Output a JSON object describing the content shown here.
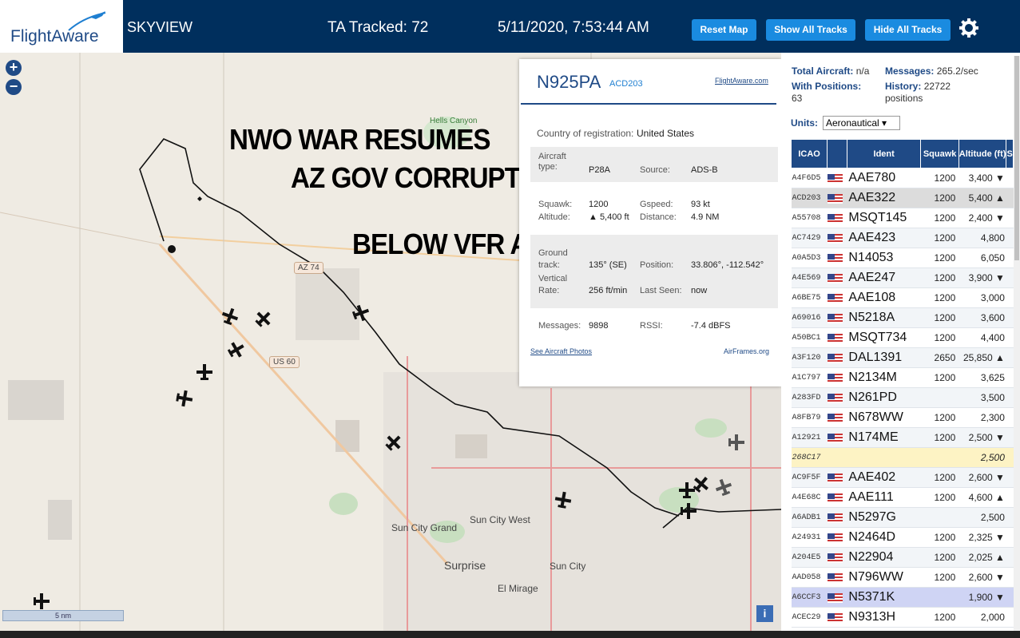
{
  "header": {
    "logo_text": "FlightAware",
    "app_name": "SKYVIEW",
    "ta_tracked": "TA Tracked: 72",
    "datetime": "5/11/2020, 7:53:44 AM",
    "reset_map": "Reset Map",
    "show_all": "Show All Tracks",
    "hide_all": "Hide All Tracks"
  },
  "map": {
    "zoom_in": "+",
    "zoom_out": "−",
    "overlay1": "NWO WAR RESUMES",
    "overlay2": "AZ GOV CORRUPTION",
    "overlay3": "BELOW VFR ASSHOLES",
    "places": [
      "Hells Canyon",
      "Sun City Grand",
      "Sun City West",
      "Surprise",
      "Sun City",
      "El Mirage"
    ],
    "shields": [
      "AZ 74",
      "US 60"
    ],
    "scale": "5 nm",
    "info": "i"
  },
  "popup": {
    "registration": "N925PA",
    "icao": "ACD203",
    "fa_link": "FlightAware.com",
    "country_label": "Country of registration:",
    "country": "United States",
    "aircraft_label": "Aircraft type:",
    "aircraft": "P28A",
    "source_label": "Source:",
    "source": "ADS-B",
    "squawk_label": "Squawk:",
    "squawk": "1200",
    "gspeed_label": "Gspeed:",
    "gspeed": "93 kt",
    "altitude_label": "Altitude:",
    "altitude": "▲ 5,400 ft",
    "distance_label": "Distance:",
    "distance": "4.9 NM",
    "track_label": "Ground track:",
    "track": "135° (SE)",
    "position_label": "Position:",
    "position": "33.806°, -112.542°",
    "vrate_label": "Vertical Rate:",
    "vrate": "256 ft/min",
    "lastseen_label": "Last Seen:",
    "lastseen": "now",
    "messages_label": "Messages:",
    "messages": "9898",
    "rssi_label": "RSSI:",
    "rssi": "-7.4 dBFS",
    "photos_link": "See Aircraft Photos",
    "airframes_link": "AirFrames.org"
  },
  "panel": {
    "total_label": "Total Aircraft:",
    "total": "n/a",
    "msgs_label": "Messages:",
    "msgs": "265.2/sec",
    "withpos_label": "With Positions:",
    "withpos": "63",
    "history_label": "History:",
    "history": "22722 positions",
    "units_label": "Units:",
    "units": "Aeronautical ▾",
    "columns": [
      "ICAO",
      "",
      "Ident",
      "Squawk",
      "Altitude (ft)",
      "S"
    ],
    "rows": [
      [
        "A4F6D5",
        "AAE780",
        "1200",
        "3,400 ▼"
      ],
      [
        "ACD203",
        "AAE322",
        "1200",
        "5,400 ▲"
      ],
      [
        "A55708",
        "MSQT145",
        "1200",
        "2,400 ▼"
      ],
      [
        "AC7429",
        "AAE423",
        "1200",
        "4,800"
      ],
      [
        "A0A5D3",
        "N14053",
        "1200",
        "6,050"
      ],
      [
        "A4E569",
        "AAE247",
        "1200",
        "3,900 ▼"
      ],
      [
        "A6BE75",
        "AAE108",
        "1200",
        "3,000"
      ],
      [
        "A69016",
        "N5218A",
        "1200",
        "3,600"
      ],
      [
        "A50BC1",
        "MSQT734",
        "1200",
        "4,400"
      ],
      [
        "A3F120",
        "DAL1391",
        "2650",
        "25,850 ▲"
      ],
      [
        "A1C797",
        "N2134M",
        "1200",
        "3,625"
      ],
      [
        "A283FD",
        "N261PD",
        "",
        "3,500"
      ],
      [
        "A8FB79",
        "N678WW",
        "1200",
        "2,300"
      ],
      [
        "A12921",
        "N174ME",
        "1200",
        "2,500 ▼"
      ],
      [
        "268C17",
        "",
        "",
        "2,500"
      ],
      [
        "AC9F5F",
        "AAE402",
        "1200",
        "2,600 ▼"
      ],
      [
        "A4E68C",
        "AAE111",
        "1200",
        "4,600 ▲"
      ],
      [
        "A6ADB1",
        "N5297G",
        "",
        "2,500"
      ],
      [
        "A24931",
        "N2464D",
        "1200",
        "2,325 ▼"
      ],
      [
        "A204E5",
        "N22904",
        "1200",
        "2,025 ▲"
      ],
      [
        "AAD058",
        "N796WW",
        "1200",
        "2,600 ▼"
      ],
      [
        "A6CCF3",
        "N5371K",
        "",
        "1,900 ▼"
      ],
      [
        "ACEC29",
        "N9313H",
        "1200",
        "2,000"
      ]
    ]
  }
}
